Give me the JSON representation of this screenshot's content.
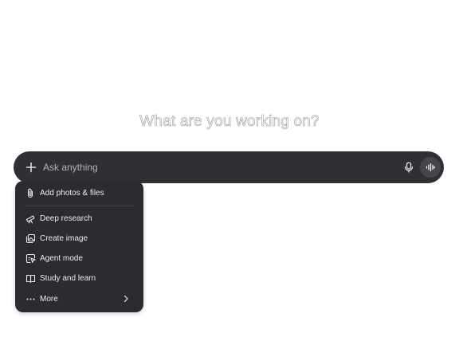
{
  "heading": "What are you working on?",
  "composer": {
    "placeholder": "Ask anything",
    "add_icon": "plus-icon",
    "mic_icon": "microphone-icon",
    "voice_icon": "voice-waveform-icon"
  },
  "menu": {
    "items": [
      {
        "label": "Add photos & files",
        "icon": "paperclip-icon"
      },
      {
        "label": "Deep research",
        "icon": "telescope-icon"
      },
      {
        "label": "Create image",
        "icon": "image-icon"
      },
      {
        "label": "Agent mode",
        "icon": "agent-cursor-icon"
      },
      {
        "label": "Study and learn",
        "icon": "book-icon"
      },
      {
        "label": "More",
        "icon": "ellipsis-icon",
        "trailing_icon": "chevron-right-icon"
      }
    ]
  },
  "colors": {
    "composer_bg": "#302f33",
    "menu_bg": "#2c2b2f",
    "menu_text": "#ececed",
    "placeholder_text": "#b3b2b7"
  }
}
